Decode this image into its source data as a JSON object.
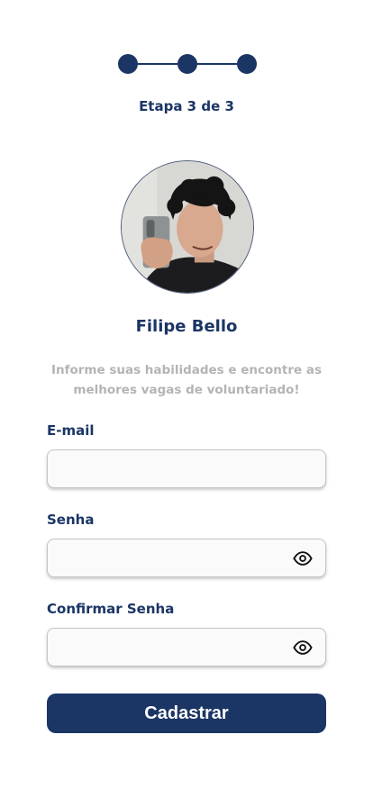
{
  "stepper": {
    "current_step": 3,
    "total_steps": 3,
    "label": "Etapa 3 de 3"
  },
  "profile": {
    "name": "Filipe Bello"
  },
  "subtitle": "Informe suas habilidades e encontre as melhores vagas de voluntariado!",
  "form": {
    "email": {
      "label": "E-mail",
      "value": "",
      "placeholder": ""
    },
    "password": {
      "label": "Senha",
      "value": "",
      "placeholder": "",
      "icon": "eye-icon"
    },
    "confirm_password": {
      "label": "Confirmar Senha",
      "value": "",
      "placeholder": "",
      "icon": "eye-icon"
    },
    "submit_label": "Cadastrar"
  },
  "colors": {
    "primary": "#1b3564",
    "muted_text": "#b4b4b4",
    "field_border": "#c4c4c4"
  }
}
